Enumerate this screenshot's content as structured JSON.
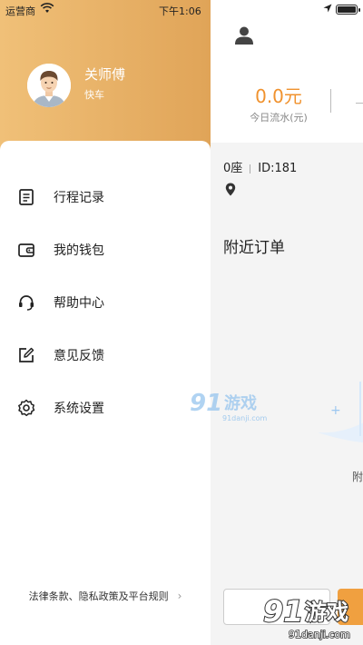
{
  "status_bar": {
    "carrier": "运营商",
    "time": "下午1:06"
  },
  "drawer": {
    "user": {
      "name": "关师傅",
      "subtitle": "快车"
    },
    "menu": [
      {
        "label": "行程记录",
        "icon": "trip-record-icon"
      },
      {
        "label": "我的钱包",
        "icon": "wallet-icon"
      },
      {
        "label": "帮助中心",
        "icon": "headset-icon"
      },
      {
        "label": "意见反馈",
        "icon": "feedback-edit-icon"
      },
      {
        "label": "系统设置",
        "icon": "gear-icon"
      }
    ],
    "legal_link": "法律条款、隐私政策及平台规则"
  },
  "main": {
    "income_value": "0.0元",
    "income_label": "今日流水(元)",
    "seats": "0座",
    "driver_id": "ID:181",
    "nearby_orders_title": "附近订单",
    "partial_char": "附"
  },
  "watermark": {
    "text": "91游戏",
    "site": "91danji.com"
  },
  "colors": {
    "accent": "#f0922e",
    "header_gradient_start": "#f0c078",
    "header_gradient_end": "#e0a458"
  }
}
